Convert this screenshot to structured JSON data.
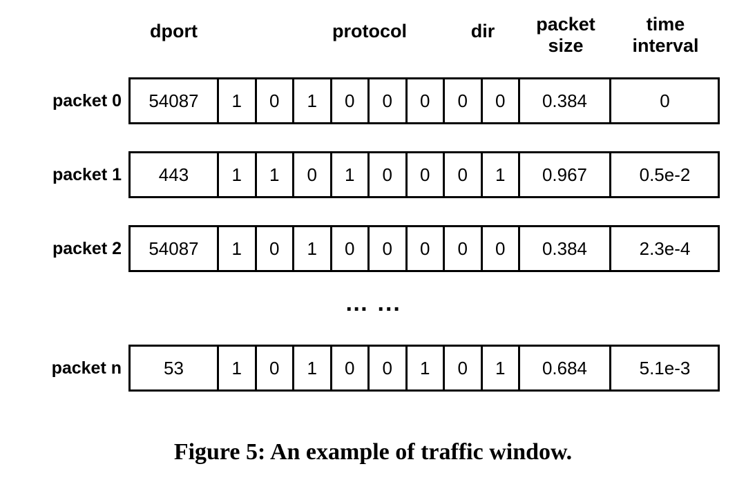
{
  "figure": {
    "caption": "Figure 5: An example of traffic window.",
    "ellipsis": "… ...",
    "columns": {
      "dport": "dport",
      "protocol": "protocol",
      "dir": "dir",
      "packet_size": "packet\nsize",
      "time_interval": "time\ninterval"
    },
    "rows": [
      {
        "label": "packet 0",
        "dport": "54087",
        "bits": [
          "1",
          "0",
          "1",
          "0",
          "0",
          "0",
          "0",
          "0"
        ],
        "packet_size": "0.384",
        "time_interval": "0"
      },
      {
        "label": "packet 1",
        "dport": "443",
        "bits": [
          "1",
          "1",
          "0",
          "1",
          "0",
          "0",
          "0",
          "1"
        ],
        "packet_size": "0.967",
        "time_interval": "0.5e-2"
      },
      {
        "label": "packet 2",
        "dport": "54087",
        "bits": [
          "1",
          "0",
          "1",
          "0",
          "0",
          "0",
          "0",
          "0"
        ],
        "packet_size": "0.384",
        "time_interval": "2.3e-4"
      },
      {
        "label": "packet n",
        "dport": "53",
        "bits": [
          "1",
          "0",
          "1",
          "0",
          "0",
          "1",
          "0",
          "1"
        ],
        "packet_size": "0.684",
        "time_interval": "5.1e-3"
      }
    ]
  }
}
